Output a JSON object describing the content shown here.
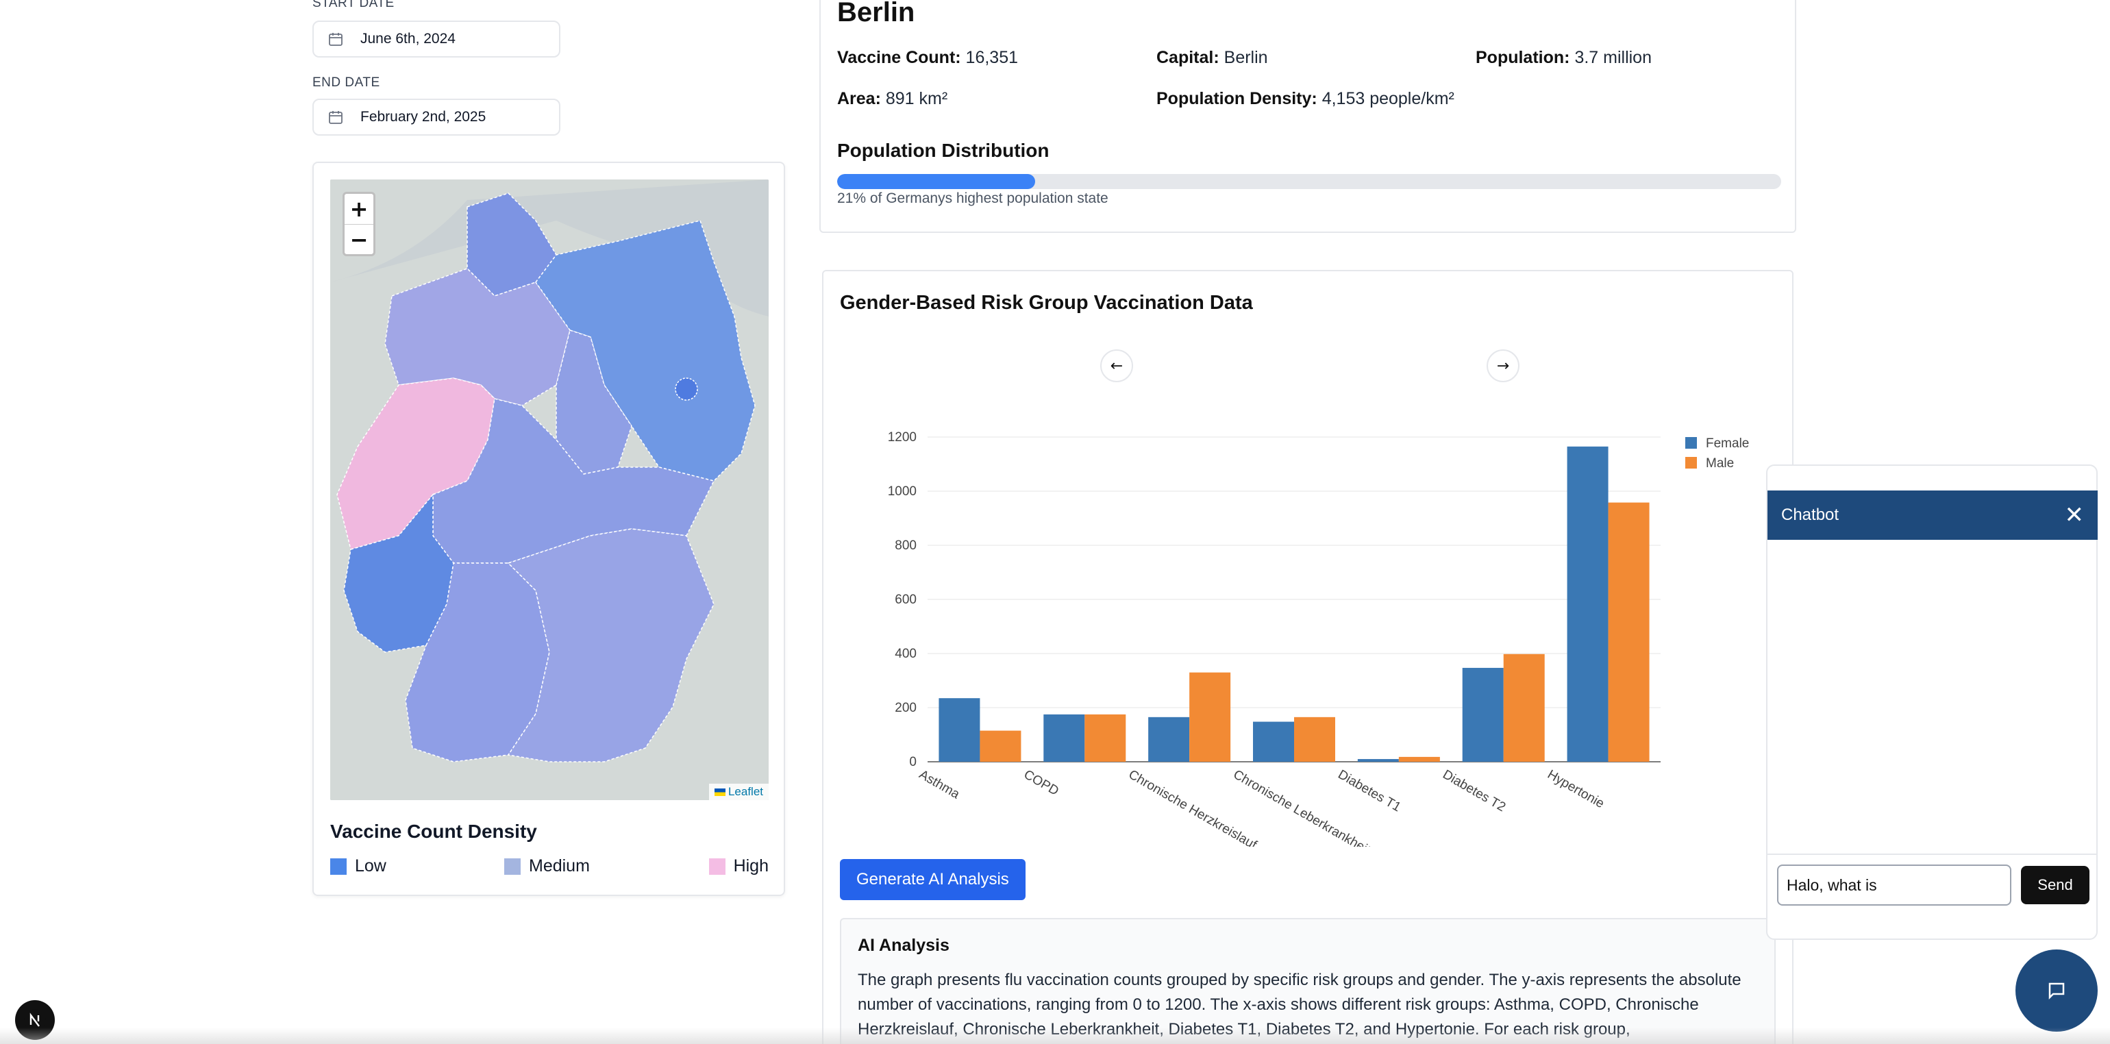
{
  "filters": {
    "start_label": "START DATE",
    "start_value": "June 6th, 2024",
    "end_label": "END DATE",
    "end_value": "February 2nd, 2025"
  },
  "map": {
    "attribution": "Leaflet",
    "zoom_in": "+",
    "zoom_out": "−",
    "legend_title": "Vaccine Count Density",
    "legend": [
      {
        "label": "Low",
        "color": "#4a86e8"
      },
      {
        "label": "Medium",
        "color": "#a4b5e0"
      },
      {
        "label": "High",
        "color": "#f4bde4"
      }
    ],
    "colors": {
      "low": "#5b8de6",
      "medium": "#9aa6e6",
      "high": "#f2b9e2",
      "background": "#cdd5d4"
    }
  },
  "state": {
    "name": "Berlin",
    "vaccine_count_label": "Vaccine Count:",
    "vaccine_count": "16,351",
    "capital_label": "Capital:",
    "capital": "Berlin",
    "population_label": "Population:",
    "population": "3.7 million",
    "area_label": "Area:",
    "area": "891 km²",
    "density_label": "Population Density:",
    "density": "4,153 people/km²",
    "distribution_title": "Population Distribution",
    "distribution_fraction": 0.21,
    "distribution_note": "21% of Germanys highest population state",
    "accent": "#3b82f6"
  },
  "chart_section": {
    "title": "Gender-Based Risk Group Vaccination Data",
    "prev_icon": "arrow-left-icon",
    "next_icon": "arrow-right-icon",
    "generate_button": "Generate AI Analysis",
    "ai_title": "AI Analysis",
    "ai_text": "The graph presents flu vaccination counts grouped by specific risk groups and gender. The y-axis represents the absolute number of vaccinations, ranging from 0 to 1200. The x-axis shows different risk groups: Asthma, COPD, Chronische Herzkreislauf, Chronische Leberkrankheit, Diabetes T1, Diabetes T2, and Hypertonie. For each risk group,"
  },
  "chart_data": {
    "type": "bar",
    "categories": [
      "Asthma",
      "COPD",
      "Chronische Herzkreislauf",
      "Chronische Leberkrankheit",
      "Diabetes T1",
      "Diabetes T2",
      "Hypertonie"
    ],
    "series": [
      {
        "name": "Female",
        "color": "#3a78b4",
        "values": [
          235,
          175,
          165,
          148,
          10,
          347,
          1165
        ]
      },
      {
        "name": "Male",
        "color": "#f28a34",
        "values": [
          115,
          175,
          330,
          165,
          18,
          398,
          958
        ]
      }
    ],
    "yticks": [
      "0",
      "200",
      "400",
      "600",
      "800",
      "1000",
      "1200"
    ],
    "ylim": [
      0,
      1200
    ],
    "grid": true,
    "legend": "top-right"
  },
  "chatbot": {
    "title": "Chatbot",
    "close_icon": "close-icon",
    "input_value": "Halo, what is ",
    "send_label": "Send",
    "header_color": "#1e4a7c"
  },
  "badge": {
    "letter": "N"
  }
}
